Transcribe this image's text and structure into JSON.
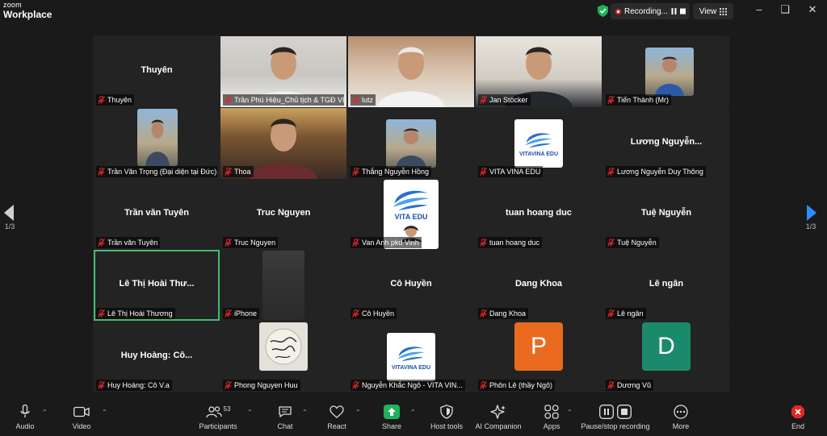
{
  "app": {
    "small": "zoom",
    "name": "Workplace"
  },
  "recording": {
    "label": "Recording..."
  },
  "view": {
    "label": "View"
  },
  "pager": {
    "left": "1/3",
    "right": "1/3"
  },
  "tiles": [
    {
      "caption": "Thuyên",
      "center": "Thuyên",
      "kind": "name"
    },
    {
      "caption": "Trần Phú Hiệu_Chủ tịch & TGĐ VI...",
      "kind": "video"
    },
    {
      "caption": "lutz",
      "kind": "video"
    },
    {
      "caption": "Jan Stöcker",
      "kind": "video"
    },
    {
      "caption": "Tiến Thành (Mr)",
      "kind": "photo"
    },
    {
      "caption": "Trần Văn Trọng (Đại diện tại Đức)",
      "kind": "photo"
    },
    {
      "caption": "Thoa",
      "kind": "video"
    },
    {
      "caption": "Thắng Nguyễn Hồng",
      "kind": "photo"
    },
    {
      "caption": "VITA VINA EDU",
      "kind": "logo",
      "logo_text": "VITAVINA EDU"
    },
    {
      "caption": "Lương Nguyễn Duy Thông",
      "center": "Lương  Nguyễn...",
      "kind": "name"
    },
    {
      "caption": "Trần văn Tuyên",
      "center": "Trần văn Tuyên",
      "kind": "name"
    },
    {
      "caption": "Truc Nguyen",
      "center": "Truc Nguyen",
      "kind": "name"
    },
    {
      "caption": "Van Anh pkd Vinh",
      "kind": "logo-video",
      "logo_text": "VITA EDU"
    },
    {
      "caption": "tuan hoang duc",
      "center": "tuan hoang duc",
      "kind": "name"
    },
    {
      "caption": "Tuệ Nguyễn",
      "center": "Tuệ Nguyễn",
      "kind": "name"
    },
    {
      "caption": "Lê Thị Hoài Thương",
      "center": "Lê Thị Hoài Thư...",
      "kind": "name",
      "active": true
    },
    {
      "caption": "iPhone",
      "kind": "blur"
    },
    {
      "caption": "Cô Huyền",
      "center": "Cô Huyền",
      "kind": "name"
    },
    {
      "caption": "Dang Khoa",
      "center": "Dang Khoa",
      "kind": "name"
    },
    {
      "caption": "Lê ngân",
      "center": "Lê ngân",
      "kind": "name"
    },
    {
      "caption": "Huy Hoàng: Cô V.a",
      "center": "Huy Hoàng: Cô...",
      "kind": "name"
    },
    {
      "caption": "Phong Nguyen Huu",
      "kind": "photo-sign"
    },
    {
      "caption": "Nguyễn Khắc Ngô - VITA VIN...",
      "kind": "logo",
      "logo_text": "VITAVINA EDU"
    },
    {
      "caption": "Phôn Lê (thầy Ngô)",
      "kind": "letter",
      "letter": "P",
      "color": "#ea6a1f"
    },
    {
      "caption": "Dương Vũ",
      "kind": "letter",
      "letter": "D",
      "color": "#1a8a6a"
    }
  ],
  "toolbar": {
    "audio": "Audio",
    "video": "Video",
    "participants": "Participants",
    "participants_count": "53",
    "chat": "Chat",
    "react": "React",
    "share": "Share",
    "host_tools": "Host tools",
    "ai": "AI Companion",
    "apps": "Apps",
    "pause_rec": "Pause/stop recording",
    "more": "More",
    "end": "End"
  },
  "colors": {
    "active_border": "#3fbf6f",
    "share_green": "#1fb25a",
    "mic_off_red": "#e02828"
  }
}
